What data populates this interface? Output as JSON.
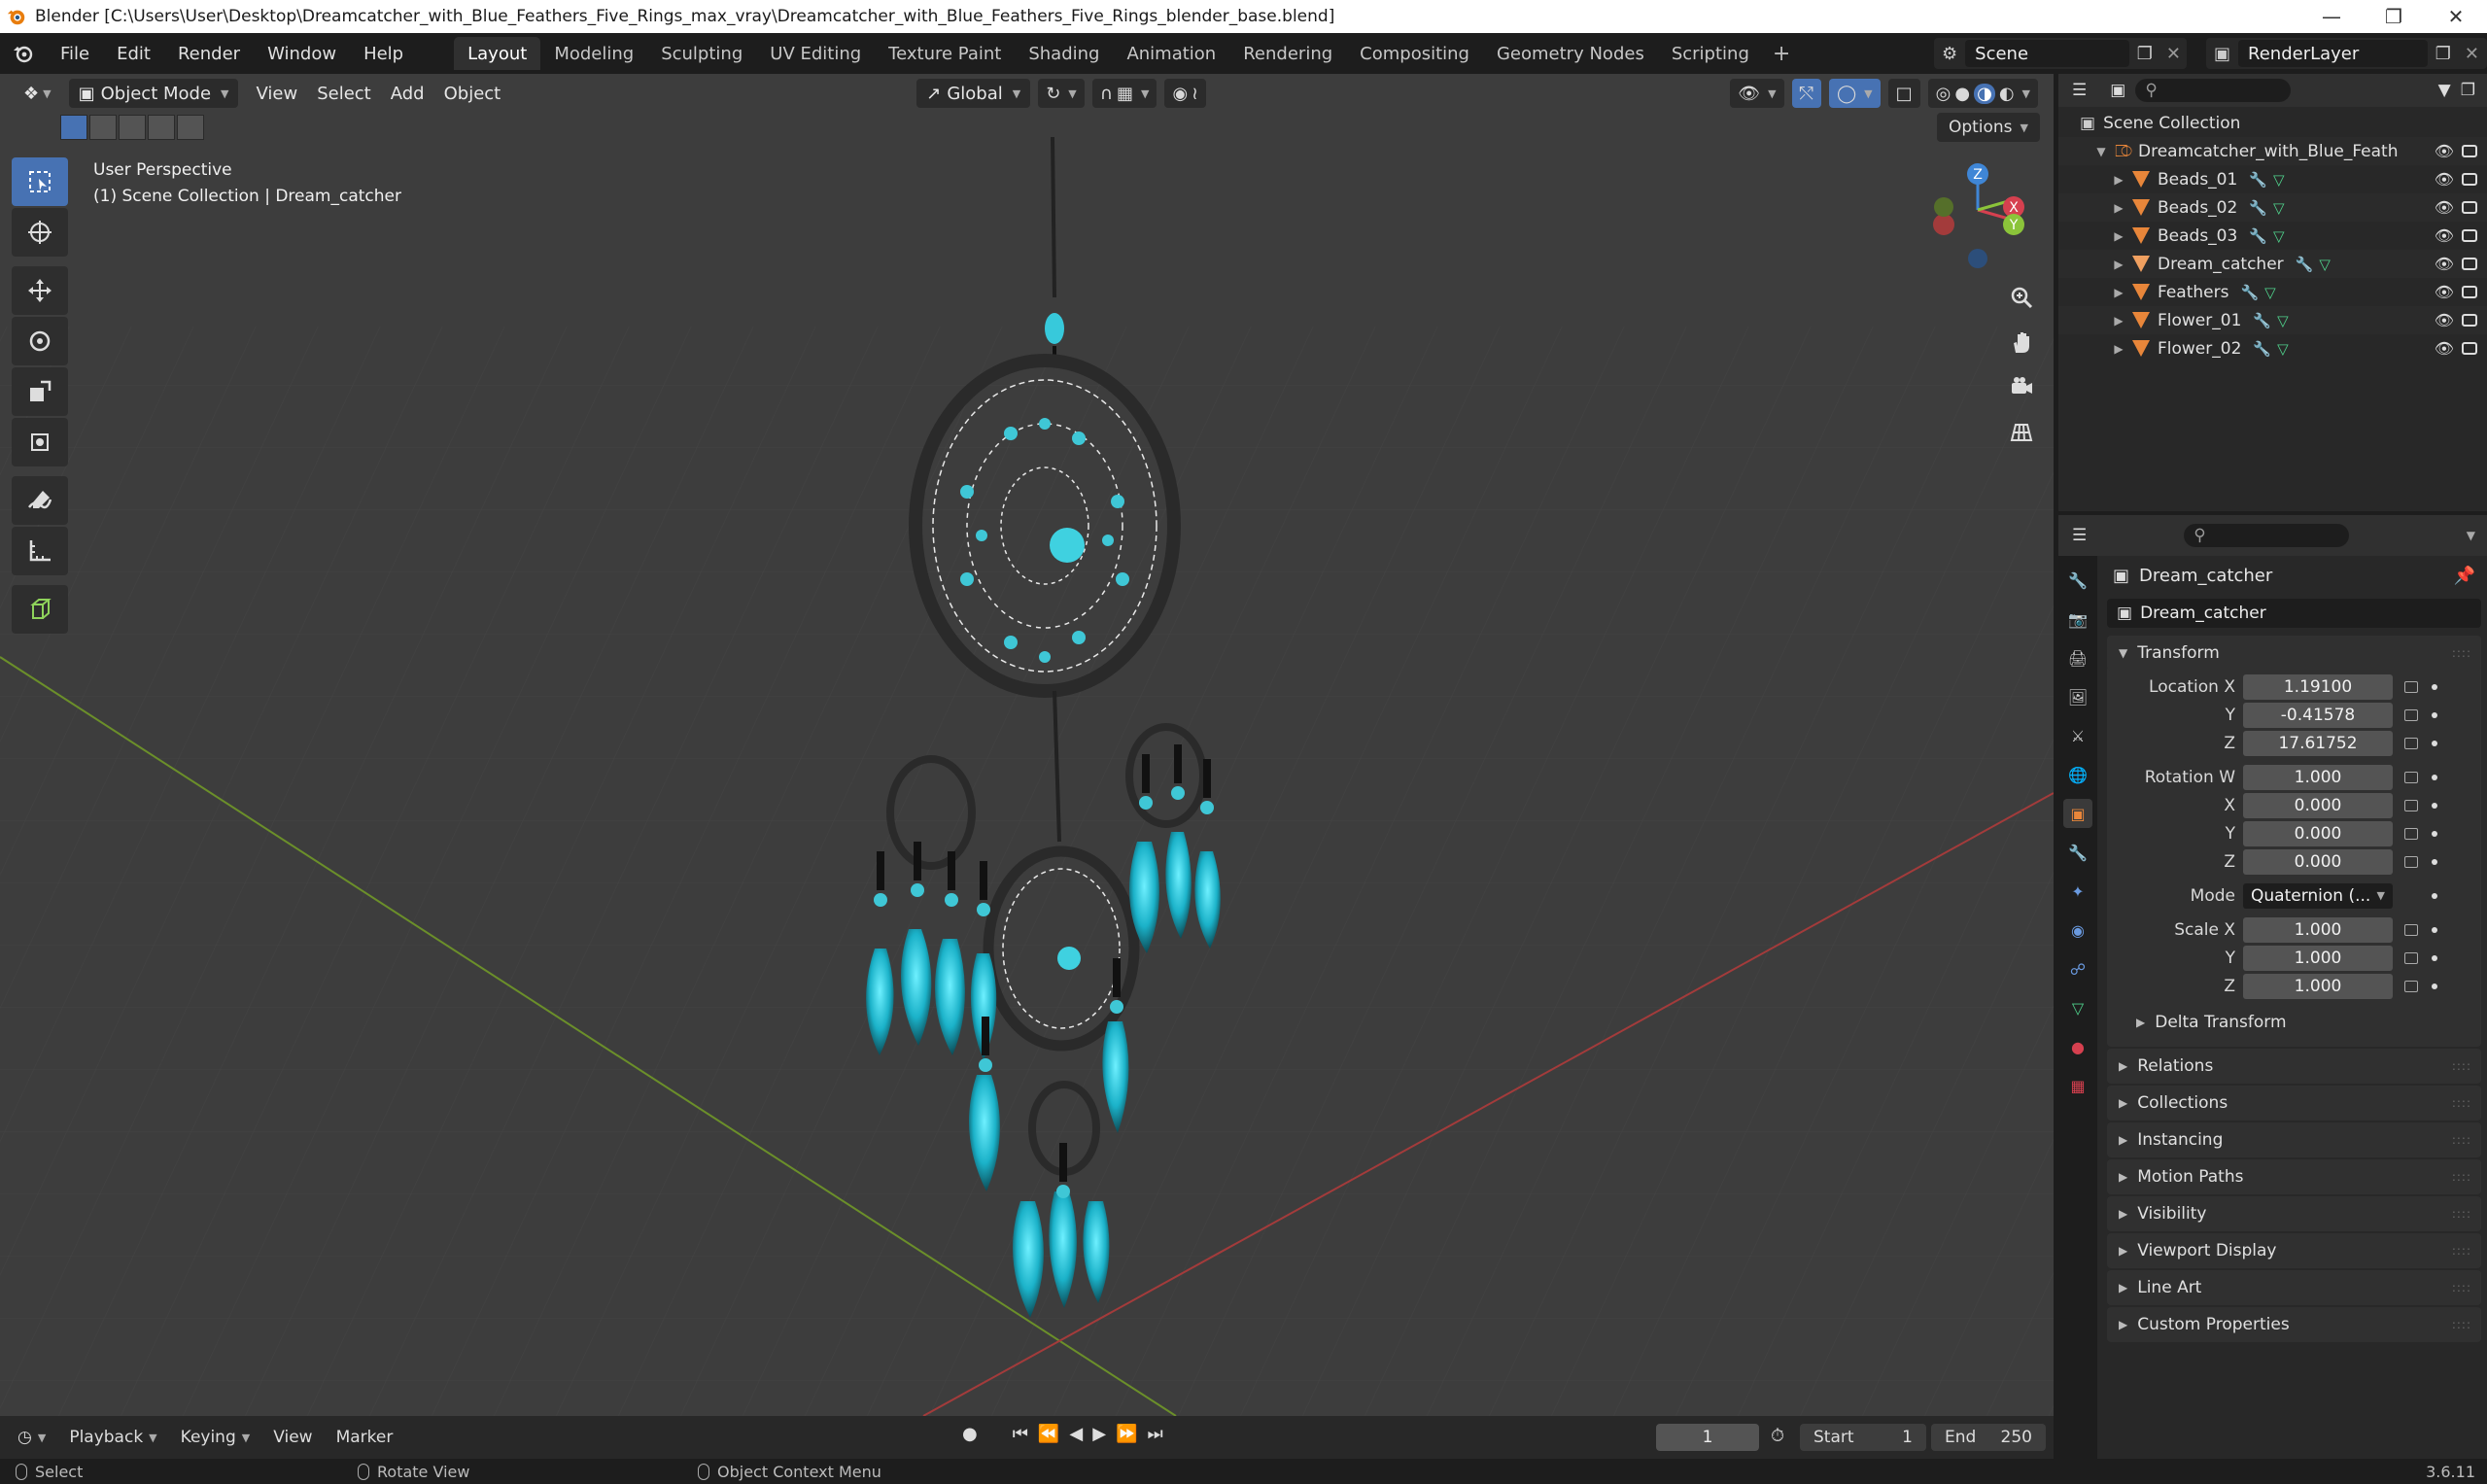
{
  "window": {
    "title": "Blender [C:\\Users\\User\\Desktop\\Dreamcatcher_with_Blue_Feathers_Five_Rings_max_vray\\Dreamcatcher_with_Blue_Feathers_Five_Rings_blender_base.blend]"
  },
  "menu": [
    "File",
    "Edit",
    "Render",
    "Window",
    "Help"
  ],
  "workspaces": [
    "Layout",
    "Modeling",
    "Sculpting",
    "UV Editing",
    "Texture Paint",
    "Shading",
    "Animation",
    "Rendering",
    "Compositing",
    "Geometry Nodes",
    "Scripting"
  ],
  "active_workspace": "Layout",
  "scene_name": "Scene",
  "render_layer": "RenderLayer",
  "viewport": {
    "mode": "Object Mode",
    "menus": [
      "View",
      "Select",
      "Add",
      "Object"
    ],
    "orientation": "Global",
    "options_label": "Options",
    "info_line1": "User Perspective",
    "info_line2": "(1) Scene Collection | Dream_catcher",
    "gizmo_axes": [
      "Z",
      "X",
      "Y"
    ]
  },
  "outliner": {
    "root": "Scene Collection",
    "collection": "Dreamcatcher_with_Blue_Feath",
    "items": [
      "Beads_01",
      "Beads_02",
      "Beads_03",
      "Dream_catcher",
      "Feathers",
      "Flower_01",
      "Flower_02"
    ]
  },
  "properties": {
    "object_title": "Dream_catcher",
    "object_name": "Dream_catcher",
    "transform_label": "Transform",
    "location": {
      "label": "Location X",
      "x": "1.19100",
      "y": "-0.41578",
      "z": "17.61752"
    },
    "rotation": {
      "label": "Rotation W",
      "w": "1.000",
      "x": "0.000",
      "y": "0.000",
      "z": "0.000"
    },
    "mode_label": "Mode",
    "mode_value": "Quaternion (...",
    "scale": {
      "label": "Scale X",
      "x": "1.000",
      "y": "1.000",
      "z": "1.000"
    },
    "axis_y": "Y",
    "axis_z": "Z",
    "axis_x": "X",
    "delta_transform": "Delta Transform",
    "panels": [
      "Relations",
      "Collections",
      "Instancing",
      "Motion Paths",
      "Visibility",
      "Viewport Display",
      "Line Art",
      "Custom Properties"
    ]
  },
  "timeline": {
    "menus": [
      "Playback",
      "Keying",
      "View",
      "Marker"
    ],
    "current_frame": "1",
    "start_label": "Start",
    "start_value": "1",
    "end_label": "End",
    "end_value": "250"
  },
  "statusbar": {
    "select": "Select",
    "rotate": "Rotate View",
    "context": "Object Context Menu",
    "version": "3.6.11"
  },
  "colors": {
    "accent": "#4772b3",
    "object_orange": "#e8863a",
    "teal": "#3fc7d6",
    "x_axis": "#d6404f",
    "y_axis": "#8bc43a",
    "z_axis": "#3f86d6"
  }
}
